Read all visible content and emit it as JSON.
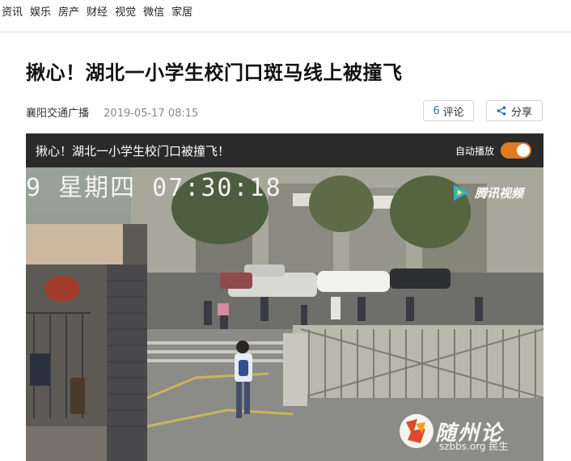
{
  "nav": {
    "items": [
      "资讯",
      "娱乐",
      "房产",
      "财经",
      "视觉",
      "微信",
      "家居"
    ]
  },
  "article": {
    "title": "揪心！湖北一小学生校门口斑马线上被撞飞",
    "source": "襄阳交通广播",
    "date": "2019-05-17 08:15",
    "comment_count": "6",
    "comment_label": "评论",
    "share_label": "分享"
  },
  "video": {
    "title": "揪心！湖北一小学生校门口被撞飞！",
    "autoplay_label": "自动播放",
    "autoplay_on": true,
    "camera_overlay": "9 星期四 07:30:18",
    "platform_logo": "腾讯视频",
    "watermark_text": "随州论",
    "watermark_url": "szbbs.org 民生"
  },
  "colors": {
    "accent": "#2d6cb5",
    "toggle": "#e07a1f",
    "player_header": "#2a2a2a"
  }
}
